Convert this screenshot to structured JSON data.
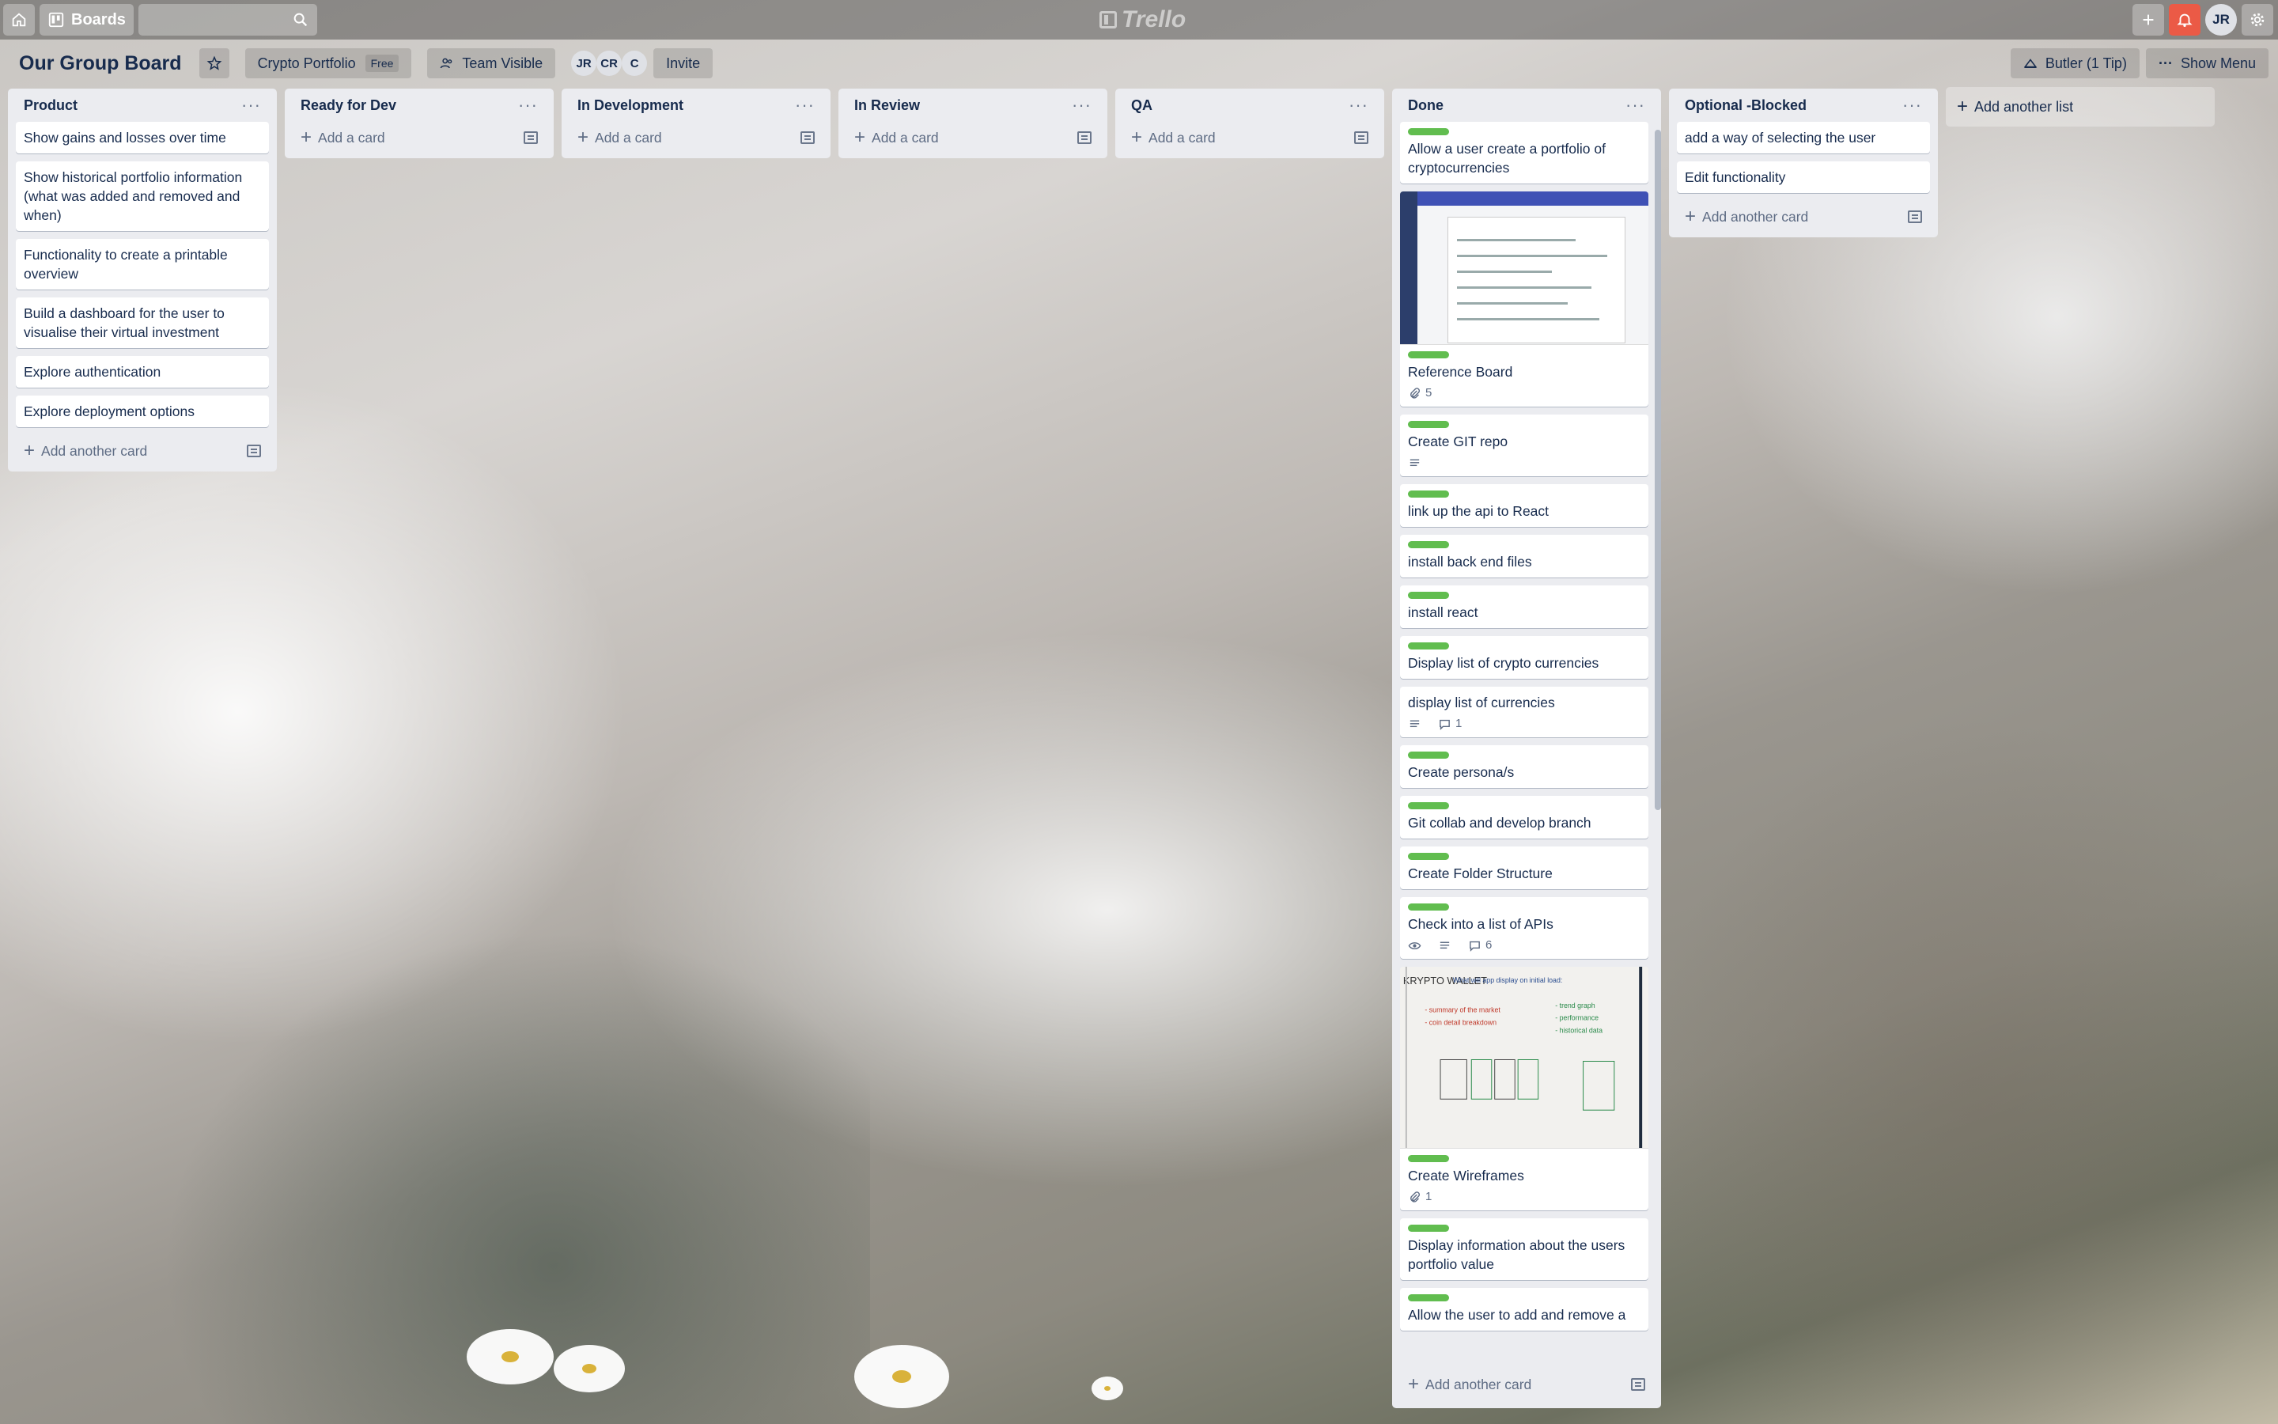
{
  "header": {
    "boards_label": "Boards",
    "search_placeholder": "",
    "logo_text": "Trello",
    "user_initials": "JR"
  },
  "board": {
    "title": "Our Group Board",
    "team_name": "Crypto Portfolio",
    "team_plan": "Free",
    "visibility": "Team Visible",
    "members": [
      "JR",
      "CR",
      "C"
    ],
    "invite_label": "Invite",
    "butler_label": "Butler (1 Tip)",
    "menu_label": "Show Menu",
    "add_list_label": "Add another list"
  },
  "lists": [
    {
      "name": "Product",
      "cards": [
        {
          "title": "Show gains and losses over time"
        },
        {
          "title": "Show historical portfolio information (what was added and removed and when)"
        },
        {
          "title": "Functionality to create a printable overview"
        },
        {
          "title": "Build a dashboard for the user to visualise their virtual investment"
        },
        {
          "title": "Explore authentication"
        },
        {
          "title": "Explore deployment options"
        }
      ],
      "add_label": "Add another card"
    },
    {
      "name": "Ready for Dev",
      "cards": [],
      "add_label": "Add a card"
    },
    {
      "name": "In Development",
      "cards": [],
      "add_label": "Add a card"
    },
    {
      "name": "In Review",
      "cards": [],
      "add_label": "Add a card"
    },
    {
      "name": "QA",
      "cards": [],
      "add_label": "Add a card"
    },
    {
      "name": "Done",
      "cards": [
        {
          "title": "Allow a user create a portfolio of cryptocurrencies",
          "label": "green"
        },
        {
          "title": "Reference Board",
          "label": "green",
          "cover": "screenshot",
          "attachments": "5"
        },
        {
          "title": "Create GIT repo",
          "label": "green",
          "description": true
        },
        {
          "title": "link up the api to React",
          "label": "green"
        },
        {
          "title": "install back end files",
          "label": "green"
        },
        {
          "title": "install react",
          "label": "green"
        },
        {
          "title": "Display list of crypto currencies",
          "label": "green"
        },
        {
          "title": "display list of currencies",
          "description": true,
          "comments": "1"
        },
        {
          "title": "Create persona/s",
          "label": "green"
        },
        {
          "title": "Git collab and develop branch",
          "label": "green"
        },
        {
          "title": "Create Folder Structure",
          "label": "green"
        },
        {
          "title": "Check into a list of APIs",
          "label": "green",
          "watching": true,
          "description": true,
          "comments": "6"
        },
        {
          "title": "Create Wireframes",
          "label": "green",
          "cover": "whiteboard",
          "attachments": "1"
        },
        {
          "title": "Display information about the users portfolio value",
          "label": "green"
        },
        {
          "title": "Allow the user to add and remove a",
          "label": "green"
        }
      ],
      "add_label": "Add another card"
    },
    {
      "name": "Optional -Blocked",
      "cards": [
        {
          "title": "add a way of selecting the user"
        },
        {
          "title": "Edit functionality"
        }
      ],
      "add_label": "Add another card"
    }
  ],
  "cover_text": {
    "whiteboard_title": "KRYPTO WALLET",
    "whiteboard_note": "What will app display on initial load:",
    "whiteboard_bullets": [
      "- summary of the market",
      "- coin detail breakdown",
      "- trend graph",
      "- performance",
      "- historical data"
    ]
  },
  "colors": {
    "label_green": "#61bd4f",
    "list_bg": "#ebecf0",
    "notification_red": "#eb5a46"
  }
}
